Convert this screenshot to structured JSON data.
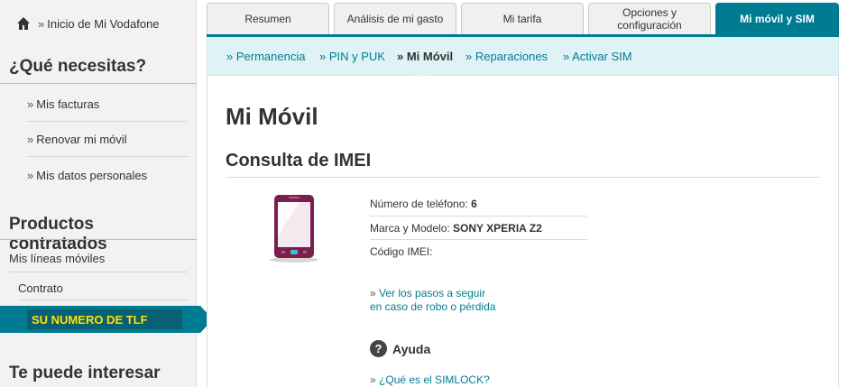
{
  "sidebar": {
    "home_link": "Inicio de Mi Vodafone",
    "chevron": "»",
    "section_needs": "¿Qué necesitas?",
    "needs_items": [
      {
        "label": "Mis facturas"
      },
      {
        "label": "Renovar mi móvil"
      },
      {
        "label": "Mis datos personales"
      }
    ],
    "section_products": "Productos contratados",
    "lines_label": "Mis líneas móviles",
    "contract_label": "Contrato",
    "active_line": "SU NUMERO DE TLF",
    "section_interest": "Te puede interesar"
  },
  "tabs": [
    {
      "label": "Resumen"
    },
    {
      "label": "Análisis de mi gasto"
    },
    {
      "label": "Mi tarifa"
    },
    {
      "label": "Opciones y configuración"
    },
    {
      "label": "Mi móvil y SIM"
    }
  ],
  "subnav": [
    {
      "label": "» Permanencia"
    },
    {
      "label": "» PIN y PUK"
    },
    {
      "label": "» Mi Móvil"
    },
    {
      "label": "» Reparaciones"
    },
    {
      "label": "» Activar SIM"
    }
  ],
  "main": {
    "page_title": "Mi Móvil",
    "section_title": "Consulta de IMEI",
    "phone_number_label": "Número de teléfono:",
    "phone_number_value": "6",
    "model_label": "Marca y Modelo:",
    "model_value": "SONY XPERIA Z2",
    "imei_label": "Código IMEI:",
    "imei_value": "",
    "theft_link_line1": "Ver los pasos a seguir",
    "theft_link_line2": "en caso de robo o pérdida",
    "help_title": "Ayuda",
    "help_icon": "question-icon",
    "help_glyph": "?",
    "simlock_link": "¿Qué es el SIMLOCK?"
  },
  "colors": {
    "accent": "#007c92",
    "highlight_text": "#ffe100",
    "phone_body": "#7a1f4e"
  }
}
